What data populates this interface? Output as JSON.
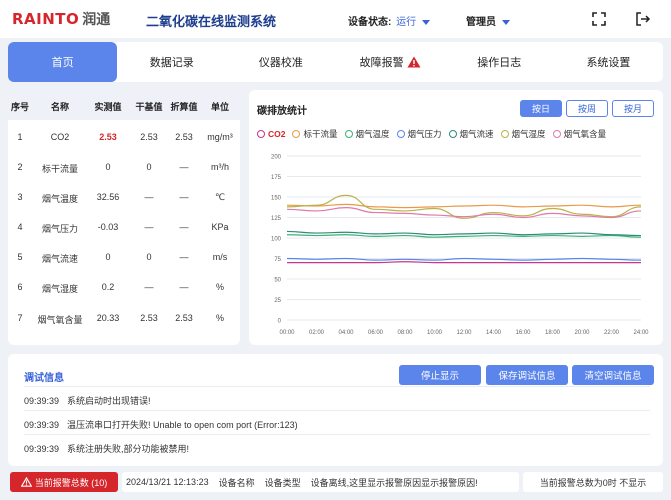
{
  "header": {
    "brand": "RAINTO",
    "brand_cn": "润通",
    "title": "二氧化碳在线监测系统",
    "status_label": "设备状态:",
    "status_value": "运行",
    "user": "管理员"
  },
  "tabs": [
    {
      "label": "首页",
      "active": true
    },
    {
      "label": "数据记录"
    },
    {
      "label": "仪器校准"
    },
    {
      "label": "故障报警",
      "warn": true
    },
    {
      "label": "操作日志"
    },
    {
      "label": "系统设置"
    }
  ],
  "table": {
    "headers": [
      "序号",
      "名称",
      "实测值",
      "干基值",
      "折算值",
      "单位"
    ],
    "rows": [
      [
        "1",
        "CO2",
        "2.53",
        "2.53",
        "2.53",
        "mg/m³"
      ],
      [
        "2",
        "标干流量",
        "0",
        "0",
        "—",
        "m³/h"
      ],
      [
        "3",
        "烟气温度",
        "32.56",
        "—",
        "—",
        "℃"
      ],
      [
        "4",
        "烟气压力",
        "-0.03",
        "—",
        "—",
        "KPa"
      ],
      [
        "5",
        "烟气流速",
        "0",
        "0",
        "—",
        "m/s"
      ],
      [
        "6",
        "烟气湿度",
        "0.2",
        "—",
        "—",
        "%"
      ],
      [
        "7",
        "烟气氧含量",
        "20.33",
        "2.53",
        "2.53",
        "%"
      ]
    ]
  },
  "chart_panel": {
    "title": "碳排放统计",
    "buttons": [
      {
        "label": "按日",
        "active": true
      },
      {
        "label": "按周"
      },
      {
        "label": "按月"
      }
    ]
  },
  "chart_data": {
    "type": "line",
    "x": [
      "00:00",
      "02:00",
      "04:00",
      "06:00",
      "08:00",
      "10:00",
      "12:00",
      "14:00",
      "16:00",
      "18:00",
      "20:00",
      "22:00",
      "24:00"
    ],
    "ylim": [
      0,
      200
    ],
    "yticks": [
      "200",
      "175",
      "150",
      "125",
      "100",
      "75",
      "50",
      "25",
      "0"
    ],
    "series": [
      {
        "name": "CO2",
        "color": "#c2378f",
        "values": [
          70,
          70,
          70,
          70,
          71,
          70,
          70,
          70,
          70,
          70,
          70,
          70,
          70
        ]
      },
      {
        "name": "标干流量",
        "color": "#e89a4a",
        "values": [
          140,
          139,
          141,
          138,
          137,
          138,
          139,
          140,
          138,
          139,
          140,
          138,
          140
        ]
      },
      {
        "name": "烟气温度",
        "color": "#3cb371",
        "values": [
          104,
          103,
          104,
          102,
          103,
          101,
          102,
          103,
          102,
          103,
          102,
          103,
          101
        ]
      },
      {
        "name": "烟气压力",
        "color": "#5b85ea",
        "values": [
          75,
          74,
          75,
          73,
          74,
          73,
          75,
          74,
          73,
          74,
          75,
          74,
          73
        ]
      },
      {
        "name": "烟气流速",
        "color": "#2e8b7a",
        "values": [
          108,
          106,
          107,
          105,
          106,
          104,
          105,
          106,
          104,
          105,
          106,
          104,
          103
        ]
      },
      {
        "name": "烟气湿度",
        "color": "#b9b24a",
        "values": [
          138,
          140,
          152,
          135,
          133,
          136,
          124,
          131,
          127,
          136,
          129,
          126,
          138
        ]
      },
      {
        "name": "烟气氧含量",
        "color": "#e07aa8",
        "values": [
          135,
          133,
          137,
          131,
          130,
          128,
          126,
          129,
          125,
          130,
          127,
          125,
          133
        ]
      }
    ]
  },
  "debug": {
    "title": "调试信息",
    "buttons": [
      "停止显示",
      "保存调试信息",
      "清空调试信息"
    ],
    "lines": [
      {
        "time": "09:39:39",
        "text": "系统启动时出现错误!"
      },
      {
        "time": "09:39:39",
        "text": "温压流串口打开失败! Unable to open com port (Error:123)"
      },
      {
        "time": "09:39:39",
        "text": "系统注册失败,部分功能被禁用!"
      }
    ]
  },
  "footer": {
    "alarm_label": "当前报警总数 (10)",
    "datetime": "2024/13/21 12:13:23",
    "device_name": "设备名称",
    "device_type": "设备类型",
    "message": "设备离线,这里显示报警原因显示报警原因!",
    "right": "当前报警总数为0时 不显示"
  }
}
